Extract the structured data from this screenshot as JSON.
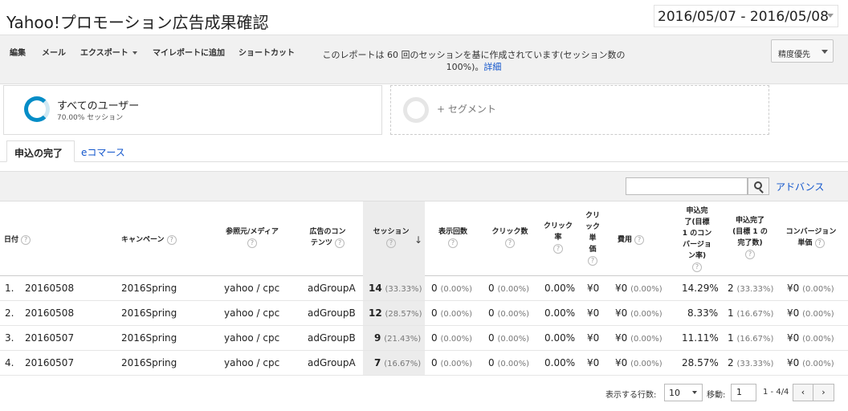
{
  "header": {
    "title": "Yahoo!プロモーション広告成果確認",
    "date_range": "2016/05/07 - 2016/05/08"
  },
  "toolbar": {
    "items": [
      "編集",
      "メール",
      "エクスポート",
      "マイレポートに追加",
      "ショートカット"
    ],
    "note_line1": "このレポートは 60 回のセッションを基に作成されています(セッション数の",
    "note_line2": "100%)。",
    "note_link": "詳細",
    "precision": "精度優先"
  },
  "segments": {
    "active_name": "すべてのユーザー",
    "active_sub": "70.00% セッション",
    "add_label": "+ セグメント"
  },
  "tabs": [
    "申込の完了",
    "eコマース"
  ],
  "controls": {
    "search_placeholder": "",
    "advanced": "アドバンス"
  },
  "table": {
    "help_glyph": "?",
    "sort_arrow": "↓",
    "headers": {
      "date": "日付",
      "campaign": "キャンペーン",
      "source": "参照元/メディア",
      "content1": "広告のコン",
      "content2": "テンツ",
      "sessions": "セッション",
      "impressions": "表示回数",
      "clicks": "クリック数",
      "ctr1": "クリック",
      "ctr2": "率",
      "cpc1": "クリ",
      "cpc2": "ック",
      "cpc3": "単",
      "cpc4": "価",
      "cost": "費用",
      "goal_rate1": "申込完",
      "goal_rate2": "了(目標",
      "goal_rate3": "1 のコン",
      "goal_rate4": "バージョ",
      "goal_rate5": "ン率)",
      "goal_done1": "申込完了",
      "goal_done2": "(目標 1 の",
      "goal_done3": "完了数)",
      "conv_value1": "コンバージョン",
      "conv_value2": "単価"
    },
    "rows": [
      {
        "idx": "1.",
        "date": "20160508",
        "campaign": "2016Spring",
        "source": "yahoo / cpc",
        "content": "adGroupA",
        "sessions": "14",
        "sessions_pct": "(33.33%)",
        "impressions": "0",
        "impressions_pct": "(0.00%)",
        "clicks": "0",
        "clicks_pct": "(0.00%)",
        "ctr": "0.00%",
        "cpc": "¥0",
        "cost": "¥0",
        "cost_pct": "(0.00%)",
        "goal_rate": "14.29%",
        "goal_done": "2",
        "goal_done_pct": "(33.33%)",
        "conv_value": "¥0",
        "conv_value_pct": "(0.00%)"
      },
      {
        "idx": "2.",
        "date": "20160508",
        "campaign": "2016Spring",
        "source": "yahoo / cpc",
        "content": "adGroupB",
        "sessions": "12",
        "sessions_pct": "(28.57%)",
        "impressions": "0",
        "impressions_pct": "(0.00%)",
        "clicks": "0",
        "clicks_pct": "(0.00%)",
        "ctr": "0.00%",
        "cpc": "¥0",
        "cost": "¥0",
        "cost_pct": "(0.00%)",
        "goal_rate": "8.33%",
        "goal_done": "1",
        "goal_done_pct": "(16.67%)",
        "conv_value": "¥0",
        "conv_value_pct": "(0.00%)"
      },
      {
        "idx": "3.",
        "date": "20160507",
        "campaign": "2016Spring",
        "source": "yahoo / cpc",
        "content": "adGroupB",
        "sessions": "9",
        "sessions_pct": "(21.43%)",
        "impressions": "0",
        "impressions_pct": "(0.00%)",
        "clicks": "0",
        "clicks_pct": "(0.00%)",
        "ctr": "0.00%",
        "cpc": "¥0",
        "cost": "¥0",
        "cost_pct": "(0.00%)",
        "goal_rate": "11.11%",
        "goal_done": "1",
        "goal_done_pct": "(16.67%)",
        "conv_value": "¥0",
        "conv_value_pct": "(0.00%)"
      },
      {
        "idx": "4.",
        "date": "20160507",
        "campaign": "2016Spring",
        "source": "yahoo / cpc",
        "content": "adGroupA",
        "sessions": "7",
        "sessions_pct": "(16.67%)",
        "impressions": "0",
        "impressions_pct": "(0.00%)",
        "clicks": "0",
        "clicks_pct": "(0.00%)",
        "ctr": "0.00%",
        "cpc": "¥0",
        "cost": "¥0",
        "cost_pct": "(0.00%)",
        "goal_rate": "28.57%",
        "goal_done": "2",
        "goal_done_pct": "(33.33%)",
        "conv_value": "¥0",
        "conv_value_pct": "(0.00%)"
      }
    ]
  },
  "pager": {
    "rows_label": "表示する行数:",
    "rows_value": "10",
    "goto_label": "移動:",
    "goto_value": "1",
    "range": "1 - 4/4",
    "prev": "‹",
    "next": "›"
  },
  "colors": {
    "accent": "#058dc7",
    "link": "#1155cc",
    "toolbar_bg": "#f1f1f1"
  }
}
